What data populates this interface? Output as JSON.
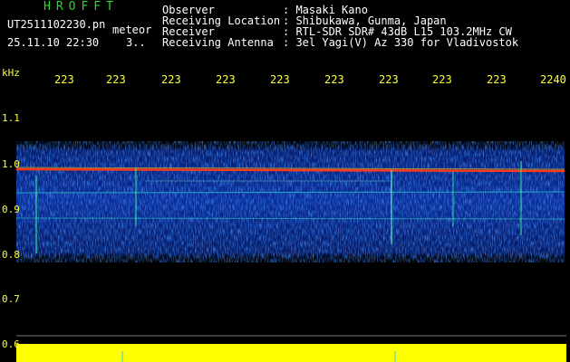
{
  "header": {
    "logo": "HROFFT",
    "filename": "UT2511102230.pn",
    "meteor_label": "meteor",
    "datetime": "25.11.10 22:30",
    "count": "3..",
    "fields": [
      {
        "label": "Observer",
        "value": ": Masaki Kano"
      },
      {
        "label": "Receiving Location",
        "value": ": Shibukawa, Gunma, Japan"
      },
      {
        "label": "Receiver",
        "value": ": RTL-SDR SDR# 43dB L15 103.2MHz CW"
      },
      {
        "label": "Receiving Antenna",
        "value": ": 3el Yagi(V) Az 330 for Vladivostok"
      }
    ]
  },
  "axis": {
    "y_unit": "kHz",
    "y_ticks": [
      "1.1",
      "1.0",
      "0.9",
      "0.8",
      "0.7",
      "0.6"
    ],
    "x_ticks": [
      "223",
      "223",
      "223",
      "223",
      "223",
      "223",
      "223",
      "223",
      "223",
      "2240"
    ]
  },
  "colors": {
    "background": "#000000",
    "axis_text": "#ffff33",
    "strip": "#ffff00",
    "logo": "#22dd22"
  }
}
